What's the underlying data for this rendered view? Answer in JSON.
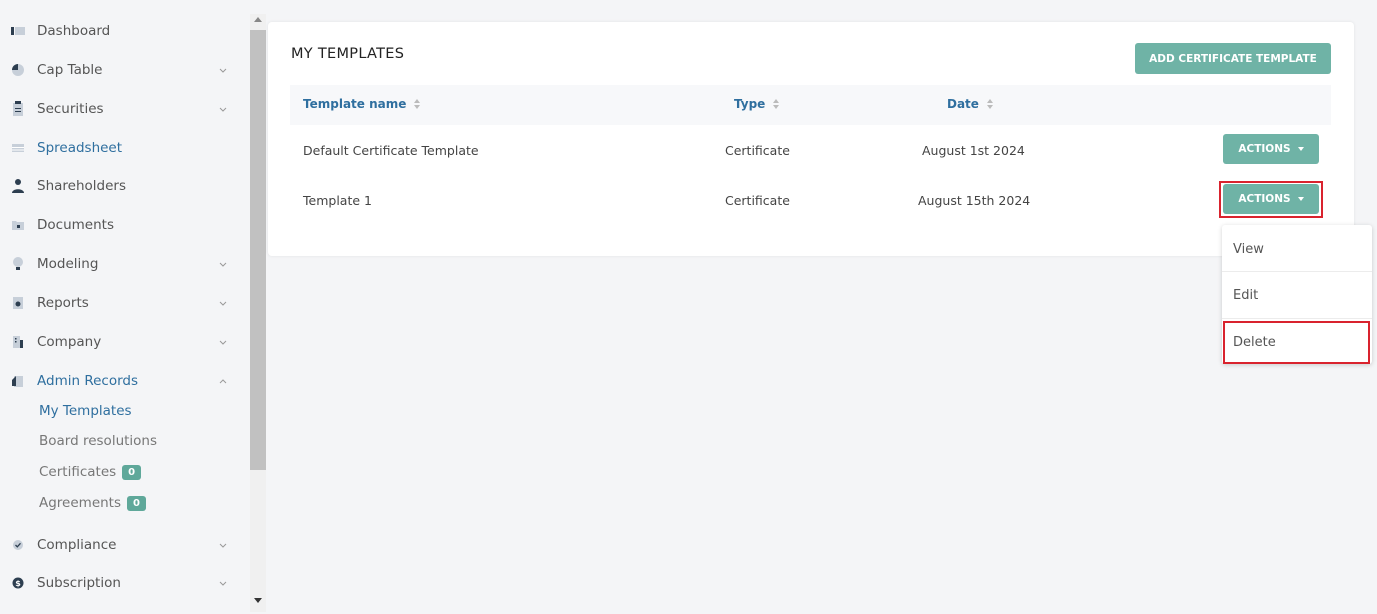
{
  "sidebar": {
    "items": [
      {
        "label": "Dashboard",
        "icon": "dashboard-icon",
        "chevron": false
      },
      {
        "label": "Cap Table",
        "icon": "pie-chart-icon",
        "chevron": true
      },
      {
        "label": "Securities",
        "icon": "clipboard-icon",
        "chevron": true
      },
      {
        "label": "Spreadsheet",
        "icon": "spreadsheet-icon",
        "chevron": false,
        "active": true
      },
      {
        "label": "Shareholders",
        "icon": "user-icon",
        "chevron": false
      },
      {
        "label": "Documents",
        "icon": "folder-lock-icon",
        "chevron": false
      },
      {
        "label": "Modeling",
        "icon": "lightbulb-icon",
        "chevron": true
      },
      {
        "label": "Reports",
        "icon": "report-icon",
        "chevron": true
      },
      {
        "label": "Company",
        "icon": "building-icon",
        "chevron": true
      },
      {
        "label": "Admin Records",
        "icon": "admin-records-icon",
        "chevron": true,
        "expanded": true,
        "active": true
      },
      {
        "label": "Compliance",
        "icon": "shield-check-icon",
        "chevron": true
      },
      {
        "label": "Subscription",
        "icon": "dollar-icon",
        "chevron": true
      }
    ],
    "sub_items": [
      {
        "label": "My Templates",
        "active": true
      },
      {
        "label": "Board resolutions"
      },
      {
        "label": "Certificates",
        "badge": "0"
      },
      {
        "label": "Agreements",
        "badge": "0"
      }
    ]
  },
  "main": {
    "title": "MY TEMPLATES",
    "add_button": "ADD CERTIFICATE TEMPLATE",
    "columns": [
      "Template name",
      "Type",
      "Date"
    ],
    "rows": [
      {
        "name": "Default Certificate Template",
        "type": "Certificate",
        "date": "August 1st 2024",
        "action": "ACTIONS"
      },
      {
        "name": "Template 1",
        "type": "Certificate",
        "date": "August 15th 2024",
        "action": "ACTIONS"
      }
    ],
    "dropdown": [
      "View",
      "Edit",
      "Delete"
    ]
  },
  "colors": {
    "accent": "#6fb3a6",
    "link": "#2f6f9f",
    "highlight": "#d9232e"
  }
}
